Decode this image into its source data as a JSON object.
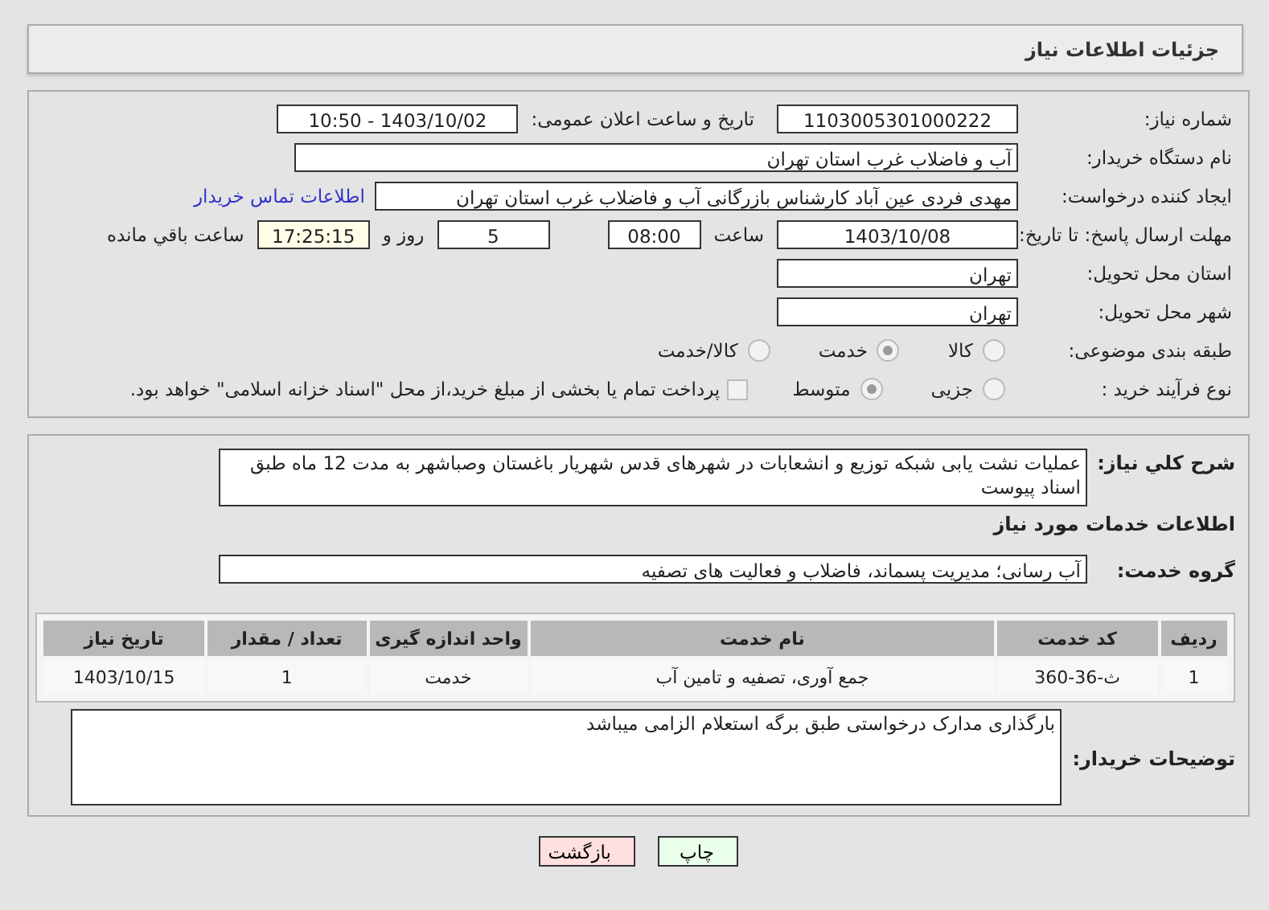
{
  "header": {
    "title": "جزئیات اطلاعات نیاز"
  },
  "need_number": {
    "label": "شماره نیاز:",
    "value": "1103005301000222"
  },
  "announce": {
    "label": "تاریخ و ساعت اعلان عمومی:",
    "value": "1403/10/02 - 10:50"
  },
  "buyer_org": {
    "label": "نام دستگاه خریدار:",
    "value": "آب و فاضلاب غرب استان تهران"
  },
  "creator": {
    "label": "ایجاد کننده درخواست:",
    "value": "مهدی فردی عین آباد کارشناس بازرگانی آب و فاضلاب غرب استان تهران",
    "link": "اطلاعات تماس خریدار"
  },
  "deadline": {
    "label": "مهلت ارسال پاسخ: تا تاریخ:",
    "date": "1403/10/08",
    "time_label": "ساعت",
    "time": "08:00",
    "days": "5",
    "days_label": "روز و",
    "remaining": "17:25:15",
    "remaining_label": "ساعت باقي مانده"
  },
  "province": {
    "label": "استان محل تحویل:",
    "value": "تهران"
  },
  "city": {
    "label": "شهر محل تحویل:",
    "value": "تهران"
  },
  "category": {
    "label": "طبقه بندی موضوعی:",
    "options": [
      {
        "label": "کالا",
        "selected": false
      },
      {
        "label": "خدمت",
        "selected": true
      },
      {
        "label": "کالا/خدمت",
        "selected": false
      }
    ]
  },
  "process": {
    "label": "نوع فرآیند خرید :",
    "options": [
      {
        "label": "جزیی",
        "selected": false
      },
      {
        "label": "متوسط",
        "selected": true
      }
    ],
    "treasury": {
      "checked": false,
      "label": "پرداخت تمام یا بخشی از مبلغ خرید،از محل \"اسناد خزانه اسلامی\" خواهد بود."
    }
  },
  "description": {
    "label": "شرح کلي نیاز:",
    "value": "عملیات نشت یابی شبکه توزیع و انشعابات در شهرهای قدس شهریار باغستان وصباشهر به مدت 12 ماه طبق اسناد پیوست"
  },
  "services_heading": "اطلاعات خدمات مورد نیاز",
  "service_group": {
    "label": "گروه خدمت:",
    "value": "آب رسانی؛ مدیریت پسماند، فاضلاب و فعالیت های تصفیه"
  },
  "table": {
    "columns": [
      "ردیف",
      "کد خدمت",
      "نام خدمت",
      "واحد اندازه گیری",
      "تعداد / مقدار",
      "تاریخ نیاز"
    ],
    "rows": [
      [
        "1",
        "ث-36-360",
        "جمع آوری، تصفیه و تامین آب",
        "خدمت",
        "1",
        "1403/10/15"
      ]
    ]
  },
  "buyer_notes": {
    "label": "توضیحات خریدار:",
    "value": "بارگذاری مدارک درخواستی طبق برگه استعلام الزامی میباشد"
  },
  "buttons": [
    {
      "label": "چاپ",
      "kind": "print"
    },
    {
      "label": "بازگشت",
      "kind": "back"
    }
  ]
}
